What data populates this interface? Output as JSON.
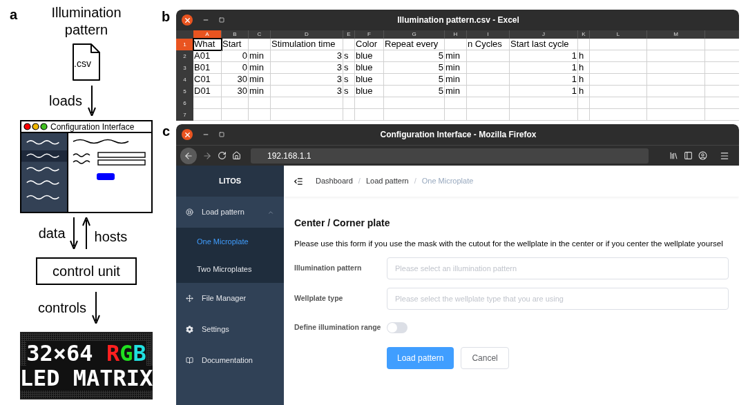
{
  "panel_a": {
    "label": "a",
    "title": "Illumination pattern",
    "file_extension": ".csv",
    "steps": [
      {
        "label": "loads"
      }
    ],
    "window_title": "Configuration Interface",
    "link": {
      "down_label": "data",
      "up_label": "hosts"
    },
    "control_unit": "control unit",
    "controls_label": "controls",
    "led_matrix": {
      "lines": [
        [
          {
            "text": "32×64 ",
            "color": "#ffffff"
          },
          {
            "text": "R",
            "color": "#ff2020"
          },
          {
            "text": "G",
            "color": "#20e020"
          },
          {
            "text": "B",
            "color": "#20e0e0"
          }
        ],
        [
          {
            "text": "LED MATRIX",
            "color": "#ffffff"
          }
        ]
      ]
    }
  },
  "panel_b": {
    "label": "b",
    "window": {
      "title": "Illumination pattern.csv - Excel"
    },
    "columns": [
      {
        "label": "A",
        "selected": true
      },
      {
        "label": "B",
        "selected": false
      },
      {
        "label": "C",
        "selected": false
      },
      {
        "label": "D",
        "selected": false
      },
      {
        "label": "E",
        "selected": false
      },
      {
        "label": "F",
        "selected": false
      },
      {
        "label": "G",
        "selected": false
      },
      {
        "label": "H",
        "selected": false
      },
      {
        "label": "I",
        "selected": false
      },
      {
        "label": "J",
        "selected": false
      },
      {
        "label": "K",
        "selected": false
      },
      {
        "label": "L",
        "selected": false
      },
      {
        "label": "M",
        "selected": false
      }
    ],
    "rows": [
      {
        "number": "1",
        "selected": true,
        "cells": [
          {
            "text": "What",
            "kind": "text"
          },
          {
            "text": "Start",
            "kind": "text"
          },
          {
            "kind": "empty"
          },
          {
            "text": "Stimulation time",
            "kind": "text"
          },
          {
            "kind": "empty"
          },
          {
            "text": "Color",
            "kind": "text"
          },
          {
            "text": "Repeat every",
            "kind": "text"
          },
          {
            "kind": "empty"
          },
          {
            "text": "n Cycles",
            "kind": "text"
          },
          {
            "text": "Start last cycle",
            "kind": "text"
          },
          {
            "kind": "empty"
          },
          {
            "kind": "empty"
          },
          {
            "kind": "empty"
          }
        ]
      },
      {
        "number": "2",
        "selected": false,
        "cells": [
          {
            "text": "A01",
            "kind": "text"
          },
          {
            "text": "0",
            "kind": "number"
          },
          {
            "text": "min",
            "kind": "text"
          },
          {
            "text": "3",
            "kind": "number"
          },
          {
            "text": "s",
            "kind": "text"
          },
          {
            "text": "blue",
            "kind": "text"
          },
          {
            "text": "5",
            "kind": "number"
          },
          {
            "text": "min",
            "kind": "text"
          },
          {
            "kind": "empty"
          },
          {
            "text": "1",
            "kind": "number"
          },
          {
            "text": "h",
            "kind": "text"
          },
          {
            "kind": "empty"
          },
          {
            "kind": "empty"
          }
        ]
      },
      {
        "number": "3",
        "selected": false,
        "cells": [
          {
            "text": "B01",
            "kind": "text"
          },
          {
            "text": "0",
            "kind": "number"
          },
          {
            "text": "min",
            "kind": "text"
          },
          {
            "text": "3",
            "kind": "number"
          },
          {
            "text": "s",
            "kind": "text"
          },
          {
            "text": "blue",
            "kind": "text"
          },
          {
            "text": "5",
            "kind": "number"
          },
          {
            "text": "min",
            "kind": "text"
          },
          {
            "kind": "empty"
          },
          {
            "text": "1",
            "kind": "number"
          },
          {
            "text": "h",
            "kind": "text"
          },
          {
            "kind": "empty"
          },
          {
            "kind": "empty"
          }
        ]
      },
      {
        "number": "4",
        "selected": false,
        "cells": [
          {
            "text": "C01",
            "kind": "text"
          },
          {
            "text": "30",
            "kind": "number"
          },
          {
            "text": "min",
            "kind": "text"
          },
          {
            "text": "3",
            "kind": "number"
          },
          {
            "text": "s",
            "kind": "text"
          },
          {
            "text": "blue",
            "kind": "text"
          },
          {
            "text": "5",
            "kind": "number"
          },
          {
            "text": "min",
            "kind": "text"
          },
          {
            "kind": "empty"
          },
          {
            "text": "1",
            "kind": "number"
          },
          {
            "text": "h",
            "kind": "text"
          },
          {
            "kind": "empty"
          },
          {
            "kind": "empty"
          }
        ]
      },
      {
        "number": "5",
        "selected": false,
        "cells": [
          {
            "text": "D01",
            "kind": "text"
          },
          {
            "text": "30",
            "kind": "number"
          },
          {
            "text": "min",
            "kind": "text"
          },
          {
            "text": "3",
            "kind": "number"
          },
          {
            "text": "s",
            "kind": "text"
          },
          {
            "text": "blue",
            "kind": "text"
          },
          {
            "text": "5",
            "kind": "number"
          },
          {
            "text": "min",
            "kind": "text"
          },
          {
            "kind": "empty"
          },
          {
            "text": "1",
            "kind": "number"
          },
          {
            "text": "h",
            "kind": "text"
          },
          {
            "kind": "empty"
          },
          {
            "kind": "empty"
          }
        ]
      },
      {
        "number": "6",
        "selected": false,
        "cells": [
          {
            "kind": "empty"
          },
          {
            "kind": "empty"
          },
          {
            "kind": "empty"
          },
          {
            "kind": "empty"
          },
          {
            "kind": "empty"
          },
          {
            "kind": "empty"
          },
          {
            "kind": "empty"
          },
          {
            "kind": "empty"
          },
          {
            "kind": "empty"
          },
          {
            "kind": "empty"
          },
          {
            "kind": "empty"
          },
          {
            "kind": "empty"
          },
          {
            "kind": "empty"
          }
        ]
      },
      {
        "number": "7",
        "selected": false,
        "cells": [
          {
            "kind": "empty"
          },
          {
            "kind": "empty"
          },
          {
            "kind": "empty"
          },
          {
            "kind": "empty"
          },
          {
            "kind": "empty"
          },
          {
            "kind": "empty"
          },
          {
            "kind": "empty"
          },
          {
            "kind": "empty"
          },
          {
            "kind": "empty"
          },
          {
            "kind": "empty"
          },
          {
            "kind": "empty"
          },
          {
            "kind": "empty"
          },
          {
            "kind": "empty"
          }
        ]
      }
    ]
  },
  "panel_c": {
    "label": "c",
    "window": {
      "title": "Configuration Interface - Mozilla Firefox"
    },
    "address": "192.168.1.1",
    "sidebar": {
      "brand": "LITOS",
      "items": [
        {
          "label": "Load pattern",
          "kind": "group",
          "expanded": true,
          "children": [
            {
              "label": "One Microplate",
              "selected": true
            },
            {
              "label": "Two Microplates",
              "selected": false
            }
          ]
        },
        {
          "label": "File Manager",
          "kind": "link"
        },
        {
          "label": "Settings",
          "kind": "link"
        },
        {
          "label": "Documentation",
          "kind": "link"
        }
      ]
    },
    "breadcrumb": [
      {
        "label": "Dashboard",
        "kind": "link"
      },
      {
        "label": "/",
        "kind": "separator"
      },
      {
        "label": "Load pattern",
        "kind": "link"
      },
      {
        "label": "/",
        "kind": "separator"
      },
      {
        "label": "One Microplate",
        "kind": "current"
      }
    ],
    "form": {
      "heading": "Center / Corner plate",
      "description": "Please use this form if you use the mask with the cutout for the wellplate in the center or if you center the wellplate yoursel",
      "fields": [
        {
          "label": "Illumination pattern",
          "placeholder": "Please select an illumination pattern"
        },
        {
          "label": "Wellplate type",
          "placeholder": "Please select the wellplate type that you are using"
        }
      ],
      "toggle": {
        "label": "Define illumination range",
        "on": false
      },
      "buttons": [
        {
          "label": "Load pattern",
          "kind": "primary"
        },
        {
          "label": "Cancel",
          "kind": "secondary"
        }
      ]
    }
  }
}
